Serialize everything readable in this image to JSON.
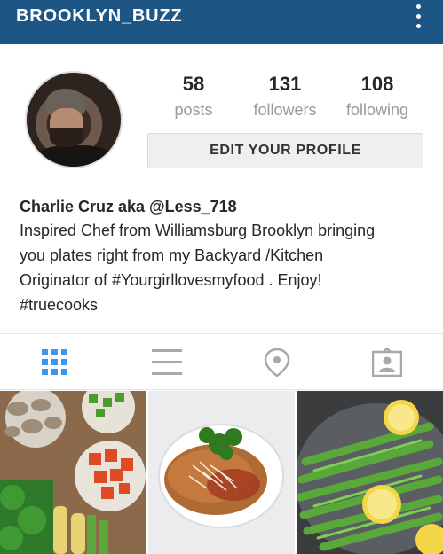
{
  "appbar": {
    "title": "BROOKLYN_BUZZ",
    "menu_icon": "more-vert-icon"
  },
  "stats": {
    "posts": {
      "count": "58",
      "label": "posts"
    },
    "followers": {
      "count": "131",
      "label": "followers"
    },
    "following": {
      "count": "108",
      "label": "following"
    }
  },
  "edit_profile_label": "EDIT YOUR PROFILE",
  "bio": {
    "name": "Charlie Cruz aka @Less_718",
    "lines": [
      "Inspired Chef from Williamsburg Brooklyn  bringing",
      "you plates right from my Backyard /Kitchen",
      "Originator of #Yourgirllovesmyfood .  Enjoy!",
      "#truecooks"
    ]
  },
  "tabs": [
    {
      "icon": "grid-view-icon",
      "active": true
    },
    {
      "icon": "list-view-icon",
      "active": false
    },
    {
      "icon": "location-pin-icon",
      "active": false
    },
    {
      "icon": "tagged-photos-icon",
      "active": false
    }
  ],
  "colors": {
    "appbar": "#1d5585",
    "active_tab": "#3897f0",
    "inactive_tab": "#a8a8a8"
  },
  "photos": [
    {
      "subject": "vegetables-photo"
    },
    {
      "subject": "chicken-cutlet-photo"
    },
    {
      "subject": "asparagus-lemon-photo"
    }
  ]
}
